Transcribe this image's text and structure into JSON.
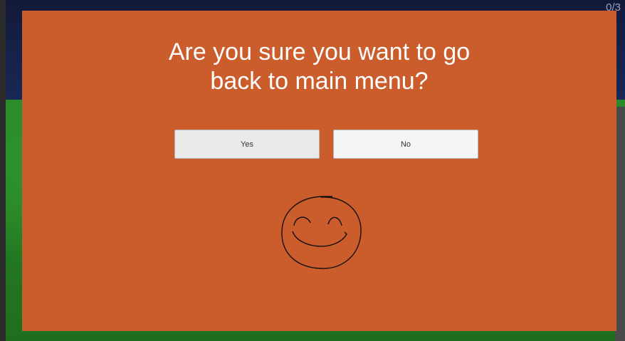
{
  "hud": {
    "counter": "0/3"
  },
  "dialog": {
    "title": "Are you sure you want to go\nback to main menu?",
    "yes_label": "Yes",
    "no_label": "No",
    "background_color": "#cb5c2b"
  },
  "decoration": {
    "smiley_icon": "hand-drawn-smiley-icon"
  }
}
